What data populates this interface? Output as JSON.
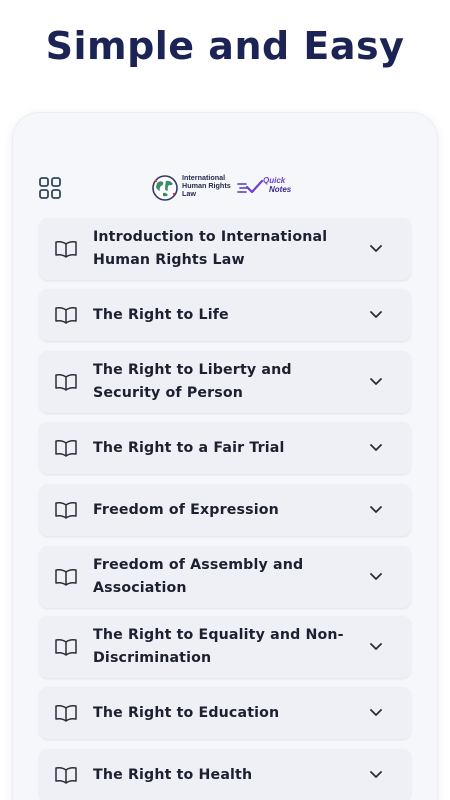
{
  "headline": "Simple and Easy",
  "logo": {
    "title_lines": [
      "International",
      "Human Rights",
      "Law"
    ],
    "notes_lines": [
      "Quick",
      "Notes"
    ]
  },
  "chapters": [
    {
      "title": "Introduction to International Human Rights Law"
    },
    {
      "title": "The Right to Life"
    },
    {
      "title": "The Right to Liberty and Security of Person"
    },
    {
      "title": "The Right to a Fair Trial"
    },
    {
      "title": "Freedom of Expression"
    },
    {
      "title": "Freedom of Assembly and Association"
    },
    {
      "title": "The Right to Equality and Non-Discrimination"
    },
    {
      "title": "The Right to Education"
    },
    {
      "title": "The Right to Health"
    }
  ],
  "icons": {
    "menu": "grid-icon",
    "chapter": "book-open-icon",
    "expand": "chevron-down-icon"
  },
  "colors": {
    "headline": "#1c2355",
    "card": "#eef0f5",
    "phone_bg": "#f6f7fb",
    "brand_purple": "#6e3fd1"
  }
}
